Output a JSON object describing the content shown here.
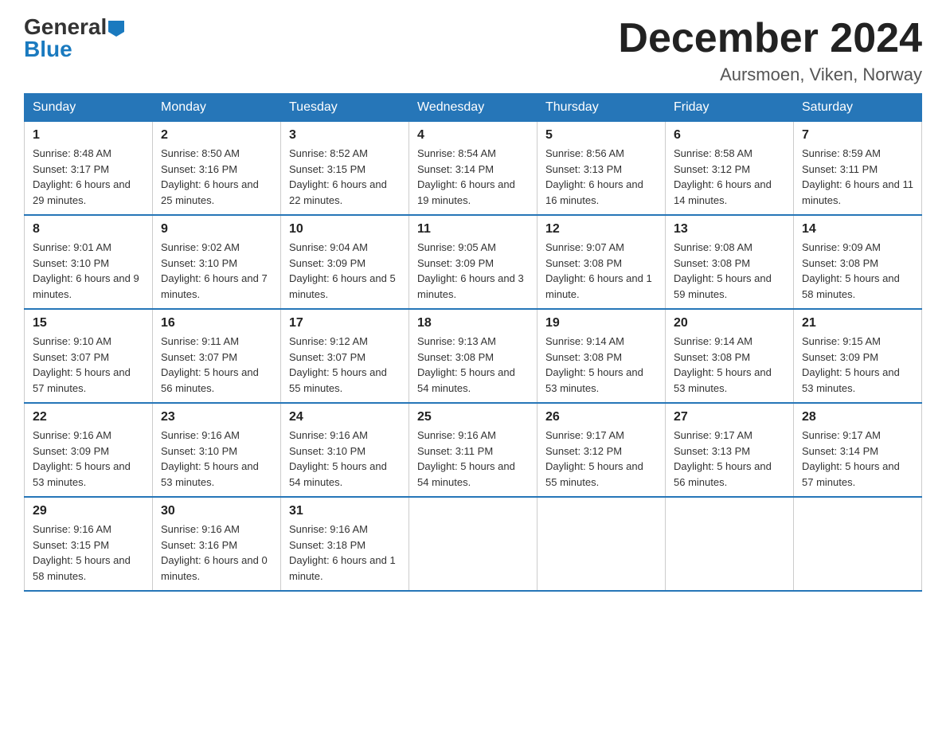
{
  "header": {
    "logo_general": "General",
    "logo_blue": "Blue",
    "month_title": "December 2024",
    "location": "Aursmoen, Viken, Norway"
  },
  "weekdays": [
    "Sunday",
    "Monday",
    "Tuesday",
    "Wednesday",
    "Thursday",
    "Friday",
    "Saturday"
  ],
  "weeks": [
    [
      {
        "day": "1",
        "sunrise": "8:48 AM",
        "sunset": "3:17 PM",
        "daylight": "6 hours and 29 minutes."
      },
      {
        "day": "2",
        "sunrise": "8:50 AM",
        "sunset": "3:16 PM",
        "daylight": "6 hours and 25 minutes."
      },
      {
        "day": "3",
        "sunrise": "8:52 AM",
        "sunset": "3:15 PM",
        "daylight": "6 hours and 22 minutes."
      },
      {
        "day": "4",
        "sunrise": "8:54 AM",
        "sunset": "3:14 PM",
        "daylight": "6 hours and 19 minutes."
      },
      {
        "day": "5",
        "sunrise": "8:56 AM",
        "sunset": "3:13 PM",
        "daylight": "6 hours and 16 minutes."
      },
      {
        "day": "6",
        "sunrise": "8:58 AM",
        "sunset": "3:12 PM",
        "daylight": "6 hours and 14 minutes."
      },
      {
        "day": "7",
        "sunrise": "8:59 AM",
        "sunset": "3:11 PM",
        "daylight": "6 hours and 11 minutes."
      }
    ],
    [
      {
        "day": "8",
        "sunrise": "9:01 AM",
        "sunset": "3:10 PM",
        "daylight": "6 hours and 9 minutes."
      },
      {
        "day": "9",
        "sunrise": "9:02 AM",
        "sunset": "3:10 PM",
        "daylight": "6 hours and 7 minutes."
      },
      {
        "day": "10",
        "sunrise": "9:04 AM",
        "sunset": "3:09 PM",
        "daylight": "6 hours and 5 minutes."
      },
      {
        "day": "11",
        "sunrise": "9:05 AM",
        "sunset": "3:09 PM",
        "daylight": "6 hours and 3 minutes."
      },
      {
        "day": "12",
        "sunrise": "9:07 AM",
        "sunset": "3:08 PM",
        "daylight": "6 hours and 1 minute."
      },
      {
        "day": "13",
        "sunrise": "9:08 AM",
        "sunset": "3:08 PM",
        "daylight": "5 hours and 59 minutes."
      },
      {
        "day": "14",
        "sunrise": "9:09 AM",
        "sunset": "3:08 PM",
        "daylight": "5 hours and 58 minutes."
      }
    ],
    [
      {
        "day": "15",
        "sunrise": "9:10 AM",
        "sunset": "3:07 PM",
        "daylight": "5 hours and 57 minutes."
      },
      {
        "day": "16",
        "sunrise": "9:11 AM",
        "sunset": "3:07 PM",
        "daylight": "5 hours and 56 minutes."
      },
      {
        "day": "17",
        "sunrise": "9:12 AM",
        "sunset": "3:07 PM",
        "daylight": "5 hours and 55 minutes."
      },
      {
        "day": "18",
        "sunrise": "9:13 AM",
        "sunset": "3:08 PM",
        "daylight": "5 hours and 54 minutes."
      },
      {
        "day": "19",
        "sunrise": "9:14 AM",
        "sunset": "3:08 PM",
        "daylight": "5 hours and 53 minutes."
      },
      {
        "day": "20",
        "sunrise": "9:14 AM",
        "sunset": "3:08 PM",
        "daylight": "5 hours and 53 minutes."
      },
      {
        "day": "21",
        "sunrise": "9:15 AM",
        "sunset": "3:09 PM",
        "daylight": "5 hours and 53 minutes."
      }
    ],
    [
      {
        "day": "22",
        "sunrise": "9:16 AM",
        "sunset": "3:09 PM",
        "daylight": "5 hours and 53 minutes."
      },
      {
        "day": "23",
        "sunrise": "9:16 AM",
        "sunset": "3:10 PM",
        "daylight": "5 hours and 53 minutes."
      },
      {
        "day": "24",
        "sunrise": "9:16 AM",
        "sunset": "3:10 PM",
        "daylight": "5 hours and 54 minutes."
      },
      {
        "day": "25",
        "sunrise": "9:16 AM",
        "sunset": "3:11 PM",
        "daylight": "5 hours and 54 minutes."
      },
      {
        "day": "26",
        "sunrise": "9:17 AM",
        "sunset": "3:12 PM",
        "daylight": "5 hours and 55 minutes."
      },
      {
        "day": "27",
        "sunrise": "9:17 AM",
        "sunset": "3:13 PM",
        "daylight": "5 hours and 56 minutes."
      },
      {
        "day": "28",
        "sunrise": "9:17 AM",
        "sunset": "3:14 PM",
        "daylight": "5 hours and 57 minutes."
      }
    ],
    [
      {
        "day": "29",
        "sunrise": "9:16 AM",
        "sunset": "3:15 PM",
        "daylight": "5 hours and 58 minutes."
      },
      {
        "day": "30",
        "sunrise": "9:16 AM",
        "sunset": "3:16 PM",
        "daylight": "6 hours and 0 minutes."
      },
      {
        "day": "31",
        "sunrise": "9:16 AM",
        "sunset": "3:18 PM",
        "daylight": "6 hours and 1 minute."
      },
      null,
      null,
      null,
      null
    ]
  ]
}
